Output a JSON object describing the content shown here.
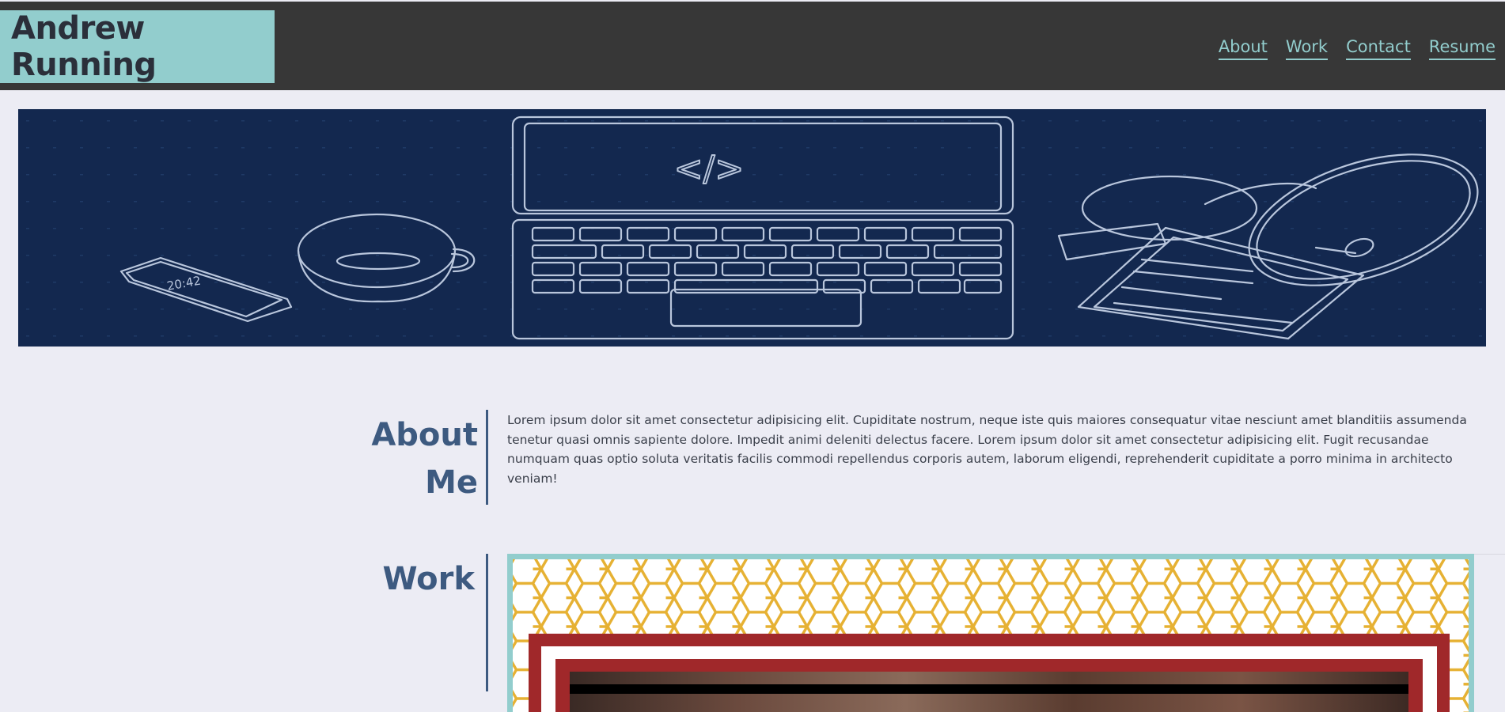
{
  "header": {
    "brand": "Andrew Running",
    "nav": [
      "About",
      "Work",
      "Contact",
      "Resume"
    ]
  },
  "hero": {
    "code_glyph": "</>",
    "phone_time": "20:42"
  },
  "about": {
    "title_line1": "About",
    "title_line2": "Me",
    "text": "Lorem ipsum dolor sit amet consectetur adipisicing elit. Cupiditate nostrum, neque iste quis maiores consequatur vitae nesciunt amet blanditiis assumenda tenetur quasi omnis sapiente dolore. Impedit animi deleniti delectus facere. Lorem ipsum dolor sit amet consectetur adipisicing elit. Fugit recusandae numquam quas optio soluta veritatis facilis commodi repellendus corporis autem, laborum eligendi, reprehenderit cupiditate a porro minima in architecto veniam!"
  },
  "work": {
    "title": "Work"
  },
  "colors": {
    "accent": "#92cdcd",
    "header_bg": "#373737",
    "page_bg": "#ececf4",
    "heading": "#3d5a80",
    "hero_bg": "#13284f",
    "honeycomb": "#e6b133",
    "frame_red": "#a0282a"
  }
}
